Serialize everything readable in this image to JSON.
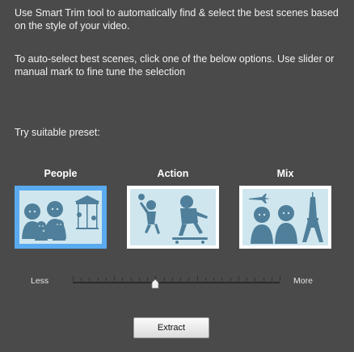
{
  "description": {
    "line1": "Use Smart Trim tool to automatically find & select the best scenes based on the style of your video.",
    "line2": "To auto-select best scenes, click one of the below options. Use slider or manual mark to fine tune the selection"
  },
  "preset": {
    "prompt": "Try suitable preset:",
    "options": [
      {
        "label": "People",
        "icon": "people-carousel-icon",
        "selected": true
      },
      {
        "label": "Action",
        "icon": "action-skate-icon",
        "selected": false
      },
      {
        "label": "Mix",
        "icon": "mix-eiffel-icon",
        "selected": false
      }
    ]
  },
  "slider": {
    "min_label": "Less",
    "max_label": "More",
    "value_fraction": 0.4
  },
  "actions": {
    "extract_label": "Extract"
  },
  "colors": {
    "background": "#4a4a4a",
    "selection_border": "#5aaaf0",
    "thumbnail_fill": "#cfe6ef",
    "figure_color": "#4f7f9a"
  }
}
